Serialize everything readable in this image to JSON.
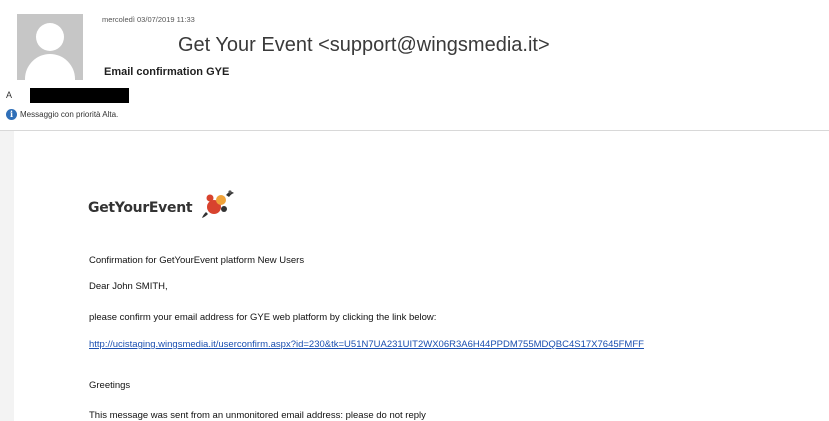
{
  "header": {
    "date": "mercoledì 03/07/2019 11:33",
    "sender": "Get Your Event <support@wingsmedia.it>",
    "subject": "Email confirmation GYE",
    "to_label": "A",
    "priority_text": "Messaggio con priorità Alta.",
    "priority_icon": "info-icon"
  },
  "body": {
    "logo_text": "GetYourEvent",
    "intro": "Confirmation for GetYourEvent platform New Users",
    "greeting": "Dear John SMITH,",
    "instruction": "please confirm your email address for GYE        web platform by clicking the link below:",
    "link": "http://ucistaging.wingsmedia.it/userconfirm.aspx?id=230&tk=U51N7UA231UIT2WX06R3A6H44PPDM755MDQBC4S17X7645FMFF",
    "closing": "Greetings",
    "footer": "This message was sent from an unmonitored email address: please do not reply"
  },
  "colors": {
    "link": "#1a4fb0",
    "info_icon": "#2f6fb8",
    "logo_red": "#d8432e",
    "logo_orange": "#f0a33a"
  }
}
